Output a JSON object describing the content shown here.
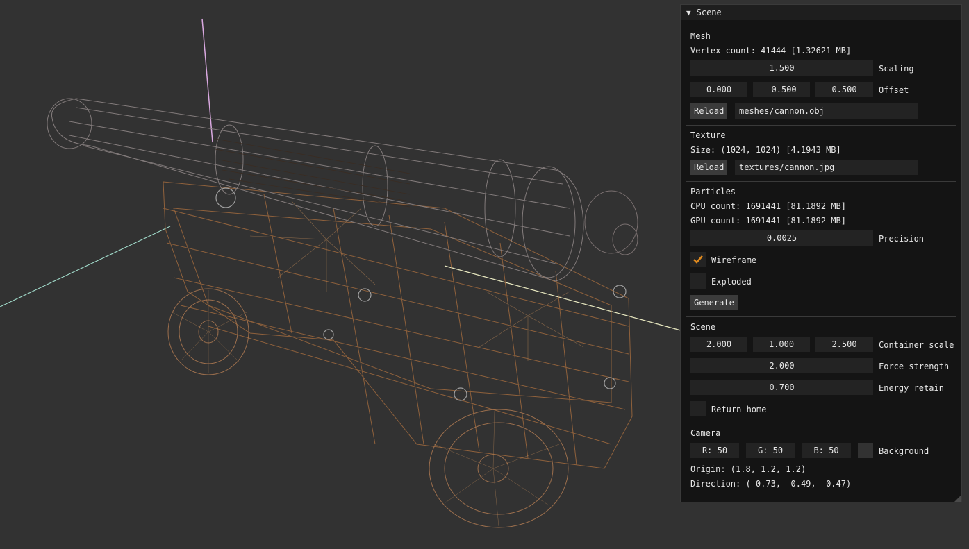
{
  "panel": {
    "title": "Scene",
    "mesh": {
      "header": "Mesh",
      "vertex_count": "Vertex count: 41444 [1.32621 MB]",
      "scaling_value": "1.500",
      "scaling_label": "Scaling",
      "offset_x": "0.000",
      "offset_y": "-0.500",
      "offset_z": "0.500",
      "offset_label": "Offset",
      "reload_label": "Reload",
      "path": "meshes/cannon.obj"
    },
    "texture": {
      "header": "Texture",
      "size": "Size: (1024, 1024) [4.1943 MB]",
      "reload_label": "Reload",
      "path": "textures/cannon.jpg"
    },
    "particles": {
      "header": "Particles",
      "cpu_count": "CPU count: 1691441 [81.1892 MB]",
      "gpu_count": "GPU count: 1691441 [81.1892 MB]",
      "precision_value": "0.0025",
      "precision_label": "Precision",
      "wireframe_label": "Wireframe",
      "wireframe_checked": true,
      "exploded_label": "Exploded",
      "exploded_checked": false,
      "generate_label": "Generate"
    },
    "scene": {
      "header": "Scene",
      "container_x": "2.000",
      "container_y": "1.000",
      "container_z": "2.500",
      "container_label": "Container scale",
      "force_value": "2.000",
      "force_label": "Force strength",
      "energy_value": "0.700",
      "energy_label": "Energy retain",
      "return_home_label": "Return home",
      "return_home_checked": false
    },
    "camera": {
      "header": "Camera",
      "r": "R: 50",
      "g": "G: 50",
      "b": "B: 50",
      "background_label": "Background",
      "origin": "Origin: (1.8, 1.2, 1.2)",
      "direction": "Direction: (-0.73, -0.49, -0.47)"
    }
  },
  "colors": {
    "background": "#323232",
    "accent_check": "#e08a1e",
    "wire_wood": "#b07848",
    "wire_metal": "#8a8a8a"
  }
}
